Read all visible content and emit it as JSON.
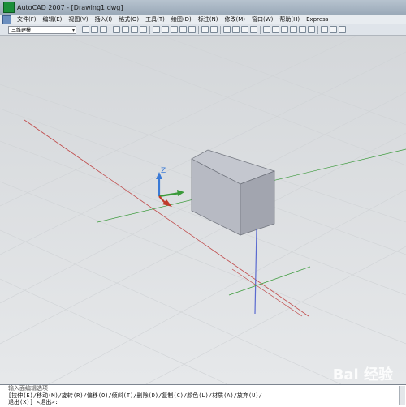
{
  "window": {
    "title": "AutoCAD 2007 - [Drawing1.dwg]"
  },
  "menubar": {
    "items": [
      "文件(F)",
      "编辑(E)",
      "视图(V)",
      "插入(I)",
      "格式(O)",
      "工具(T)",
      "绘图(D)",
      "标注(N)",
      "修改(M)",
      "窗口(W)",
      "帮助(H)",
      "Express"
    ]
  },
  "toolbar": {
    "workspace_value": "三维建模"
  },
  "viewport": {
    "ucs_axis_label": "Z"
  },
  "command": {
    "line1": "输入面编辑选项",
    "line2": "[拉伸(E)/移动(M)/旋转(R)/偏移(O)/倾斜(T)/删除(D)/复制(C)/颜色(L)/材质(A)/放弃(U)/",
    "line3": "退出(X)] <退出>:"
  },
  "watermark": {
    "text": "Bai 经验"
  },
  "colors": {
    "grid_red": "#c04a4a",
    "grid_green": "#3a9a3a",
    "axis_blue": "#5a6ad0",
    "box_face": "#a9acb6"
  }
}
